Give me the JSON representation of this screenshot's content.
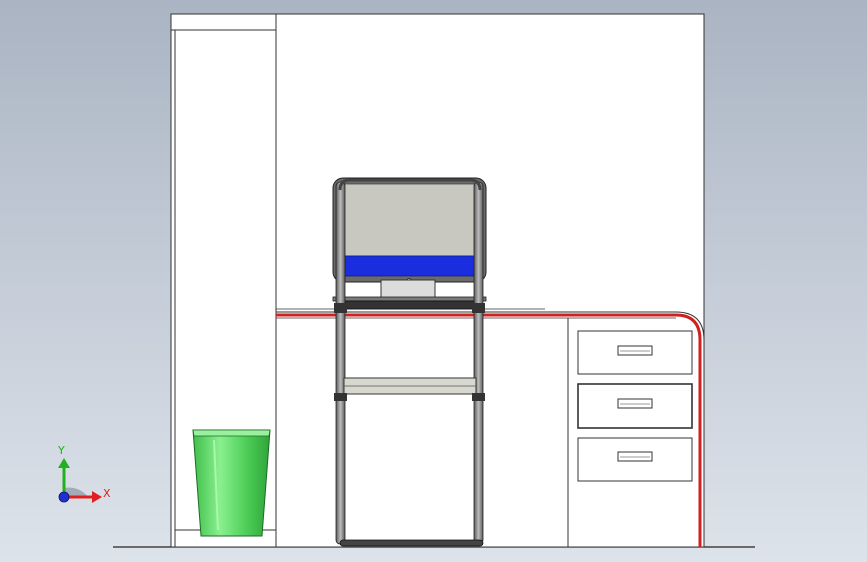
{
  "triad": {
    "x_label": "X",
    "y_label": "Y",
    "x_color": "#e02020",
    "y_color": "#20b020",
    "z_color": "#2030d0"
  },
  "scene": {
    "background_top": "#aab4c2",
    "background_bottom": "#dde3ea",
    "desk_edge_color": "#d02020",
    "screen_band_color": "#1a2ee0",
    "wastebasket_color": "#5fd86a",
    "monitor_screen_color": "#c8c8c0"
  }
}
